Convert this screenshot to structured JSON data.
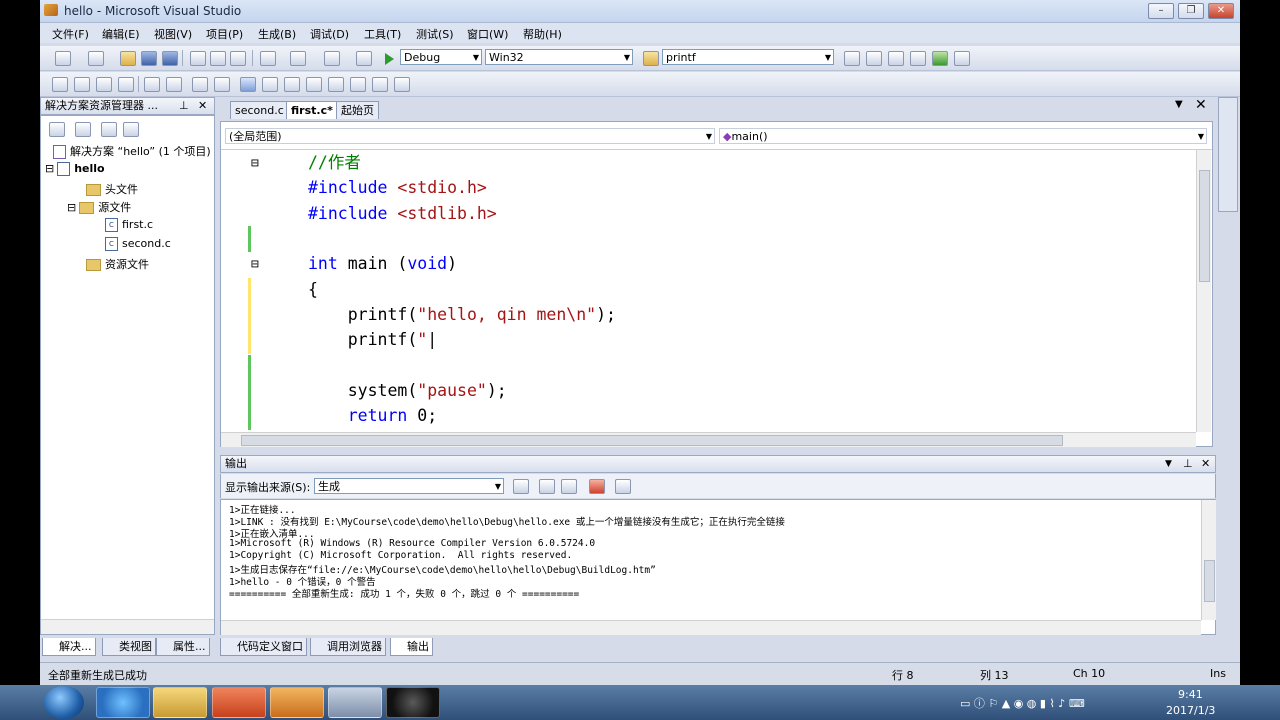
{
  "window": {
    "title": "hello - Microsoft Visual Studio",
    "minimize": "–",
    "maximize": "❐",
    "close": "✕"
  },
  "menu": [
    "文件(F)",
    "编辑(E)",
    "视图(V)",
    "项目(P)",
    "生成(B)",
    "调试(D)",
    "工具(T)",
    "测试(S)",
    "窗口(W)",
    "帮助(H)"
  ],
  "toolbar": {
    "config": "Debug",
    "platform": "Win32",
    "find": "printf"
  },
  "solution_explorer": {
    "title": "解决方案资源管理器 ...",
    "solution": "解决方案 “hello” (1 个项目)",
    "project": "hello",
    "folders": [
      "头文件",
      "源文件",
      "资源文件"
    ],
    "files": [
      "first.c",
      "second.c"
    ],
    "bottom_tabs": [
      "解决...",
      "类视图",
      "属性..."
    ]
  },
  "editor": {
    "tabs": [
      "second.c",
      "first.c*",
      "起始页"
    ],
    "scope": "(全局范围)",
    "function": "main()",
    "code": [
      {
        "parts": [
          {
            "t": "//作者",
            "c": "cmt"
          }
        ]
      },
      {
        "parts": [
          {
            "t": "#include ",
            "c": "pp"
          },
          {
            "t": "<stdio.h>",
            "c": "str"
          }
        ]
      },
      {
        "parts": [
          {
            "t": "#include ",
            "c": "pp"
          },
          {
            "t": "<stdlib.h>",
            "c": "str"
          }
        ]
      },
      {
        "parts": [
          {
            "t": "",
            "c": "plain"
          }
        ]
      },
      {
        "parts": [
          {
            "t": "int",
            "c": "kw"
          },
          {
            "t": " main ",
            "c": "plain"
          },
          {
            "t": "(",
            "c": "plain"
          },
          {
            "t": "void",
            "c": "kw"
          },
          {
            "t": ")",
            "c": "plain"
          }
        ]
      },
      {
        "parts": [
          {
            "t": "{",
            "c": "plain"
          }
        ]
      },
      {
        "parts": [
          {
            "t": "    printf(",
            "c": "plain"
          },
          {
            "t": "\"hello, qin men\\n\"",
            "c": "str"
          },
          {
            "t": ");",
            "c": "plain"
          }
        ]
      },
      {
        "parts": [
          {
            "t": "    printf(",
            "c": "plain"
          },
          {
            "t": "\"",
            "c": "str"
          },
          {
            "t": "|",
            "c": "plain"
          }
        ]
      },
      {
        "parts": [
          {
            "t": "",
            "c": "plain"
          }
        ]
      },
      {
        "parts": [
          {
            "t": "    system(",
            "c": "plain"
          },
          {
            "t": "\"pause\"",
            "c": "str"
          },
          {
            "t": ");",
            "c": "plain"
          }
        ]
      },
      {
        "parts": [
          {
            "t": "    ",
            "c": "plain"
          },
          {
            "t": "return",
            "c": "kw"
          },
          {
            "t": " 0;",
            "c": "plain"
          }
        ]
      }
    ]
  },
  "output": {
    "title": "输出",
    "source_label": "显示输出来源(S):",
    "source_value": "生成",
    "lines": [
      "1>正在链接...",
      "1>LINK : 没有找到 E:\\MyCourse\\code\\demo\\hello\\Debug\\hello.exe 或上一个增量链接没有生成它；正在执行完全链接",
      "1>正在嵌入清单...",
      "1>Microsoft (R) Windows (R) Resource Compiler Version 6.0.5724.0",
      "1>Copyright (C) Microsoft Corporation.  All rights reserved.",
      "1>生成日志保存在“file://e:\\MyCourse\\code\\demo\\hello\\hello\\Debug\\BuildLog.htm”",
      "1>hello - 0 个错误，0 个警告",
      "========== 全部重新生成: 成功 1 个，失败 0 个，跳过 0 个 =========="
    ],
    "bottom_tabs": [
      "代码定义窗口",
      "调用浏览器",
      "输出"
    ]
  },
  "status": {
    "message": "全部重新生成已成功",
    "line": "行 8",
    "col": "列 13",
    "ch": "Ch 10",
    "mode": "Ins"
  },
  "taskbar": {
    "time": "9:41",
    "date": "2017/1/3"
  }
}
